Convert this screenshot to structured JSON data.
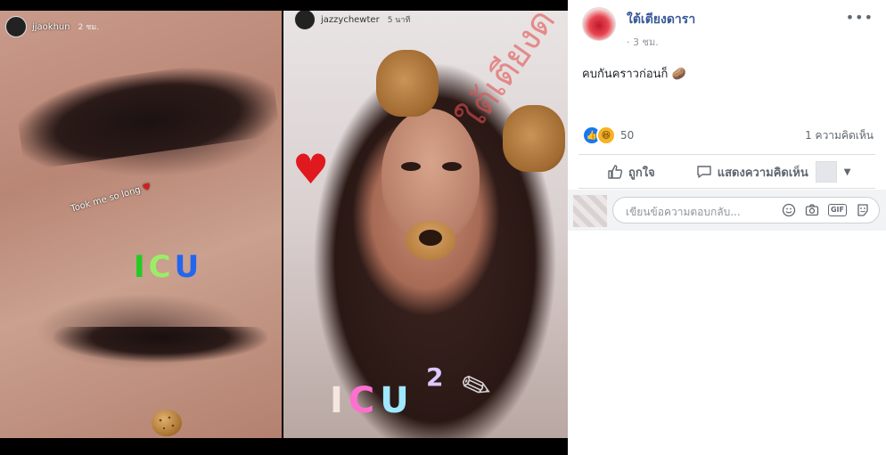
{
  "viewer": {
    "left_story": {
      "username": "jjaokhun",
      "time": "2 ชม.",
      "sticker_text": "Took me so long",
      "sticker_word": [
        "I",
        "C",
        "U"
      ]
    },
    "right_story": {
      "username": "jazzychewter",
      "time": "5 นาที",
      "sticker_word": [
        "I",
        "C",
        "U"
      ],
      "sticker_superscript": "2",
      "watermark": "ใต้เตียงดารา"
    }
  },
  "post": {
    "page_name": "ใต้เตียงดารา",
    "time": "3 ชม.",
    "caption": "คบกันคราวก่อนก็ 🥔",
    "reaction_count": "50",
    "comment_count": "1 ความคิดเห็น",
    "like_label": "ถูกใจ",
    "comment_label": "แสดงความคิดเห็น"
  },
  "comment_input": {
    "placeholder": "เขียนข้อความตอบกลับ..."
  },
  "colors": {
    "link_blue": "#385898",
    "like_blue": "#1877f2",
    "muted": "#606770"
  }
}
